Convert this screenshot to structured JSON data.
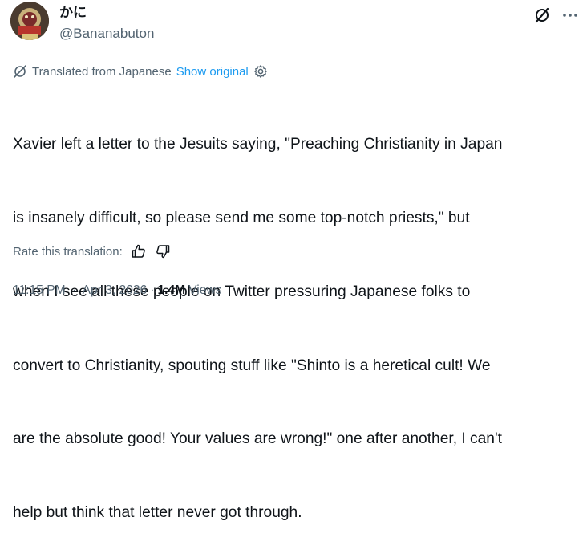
{
  "author": {
    "display_name": "かに",
    "handle": "@Bananabuton"
  },
  "translation": {
    "notice": "Translated from Japanese",
    "show_original": "Show original",
    "icon": "translate-icon",
    "settings_icon": "gear-icon"
  },
  "tweet": {
    "text_lines": [
      "Xavier left a letter to the Jesuits saying, \"Preaching Christianity in Japan",
      "is insanely difficult, so please send me some top-notch priests,\" but",
      "when I see all these people on Twitter pressuring Japanese folks to",
      "convert to Christianity, spouting stuff like \"Shinto is a heretical cult! We",
      "are the absolute good! Your values are wrong!\" one after another, I can't",
      "help but think that letter never got through."
    ]
  },
  "rating": {
    "label": "Rate this translation:",
    "thumbs_up_icon": "thumbs-up-icon",
    "thumbs_down_icon": "thumbs-down-icon"
  },
  "meta": {
    "time": "11:15 PM",
    "separator": "·",
    "date": "Apr 3, 2026",
    "views_count": "1.4M",
    "views_label": "Views"
  },
  "header_icons": {
    "grok": "grok-icon",
    "more": "more-icon"
  },
  "colors": {
    "text": "#0f1419",
    "secondary": "#536471",
    "link": "#1d9bf0"
  }
}
